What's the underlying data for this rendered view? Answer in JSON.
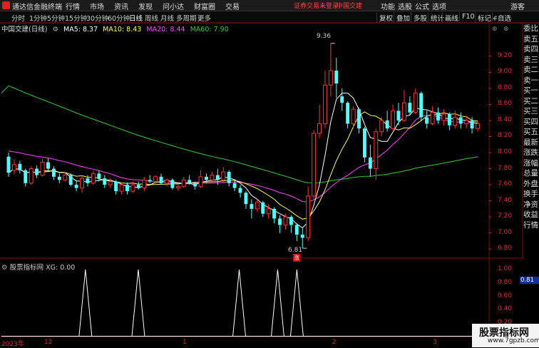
{
  "app": {
    "title": "通达信金融终端",
    "menus": [
      "行情",
      "市场",
      "资讯",
      "发现",
      "问小达",
      "财富圈",
      "交易"
    ],
    "warning": "证券交易未登录",
    "stock_link": "中国交建",
    "right_items": [
      "功能",
      "选股",
      "公式",
      "选项"
    ],
    "guest": "游客"
  },
  "toolbar": {
    "periods": [
      "分时",
      "1分钟",
      "5分钟",
      "15分钟",
      "30分钟",
      "60分钟",
      "日线",
      "周线",
      "月线",
      "多周期",
      "更多"
    ],
    "active": "日线",
    "right_buttons": [
      "复权",
      "叠加",
      "多股",
      "统计",
      "画线",
      "F10",
      "标记",
      "-"
    ]
  },
  "chart_header": {
    "name": "中国交建(日线)",
    "ma5": "MA5: 8.37",
    "ma10": "MA10: 8.43",
    "ma20": "MA20: 8.44",
    "ma60": "MA60: 7.90"
  },
  "colors": {
    "up": "#ff3333",
    "down": "#54ffff",
    "ma5": "#ffffff",
    "ma10": "#ffff4d",
    "ma20": "#ff44ff",
    "ma60": "#33cc33"
  },
  "high_label": "9.36",
  "low_label": "6.81",
  "zhang_label": "涨",
  "right_panel": {
    "items": [
      "委比",
      "卖五",
      "卖四",
      "卖三",
      "卖二",
      "卖一",
      "买一",
      "买二",
      "买三",
      "买四",
      "买五",
      "最新",
      "涨跌",
      "涨幅",
      "总量",
      "外盘",
      "换手",
      "净资",
      "收益",
      "行情"
    ],
    "auto_select": "+自选"
  },
  "indicator": {
    "name": "股票指标网",
    "value": "XG: 0.00",
    "current": "0.81",
    "spike_positions": [
      0.16,
      0.27,
      0.48,
      0.56,
      0.6
    ]
  },
  "x_labels": [
    "2023年",
    "12",
    "1",
    "2",
    "3"
  ],
  "watermark": {
    "title": "股票指标网",
    "url": "www.7gpzb.com"
  },
  "chart_data": {
    "type": "candlestick",
    "y_ticks": [
      9.2,
      9.0,
      8.8,
      8.6,
      8.4,
      8.2,
      8.0,
      7.8,
      7.6,
      7.4,
      7.2,
      7.0,
      6.8
    ],
    "indicator_ticks": [
      1.0,
      0.8,
      0.6,
      0.4,
      0.2
    ],
    "ylim": [
      6.74,
      9.5
    ],
    "candles": [
      [
        7.95,
        7.75,
        8.0,
        7.7
      ],
      [
        7.78,
        7.85,
        7.92,
        7.73
      ],
      [
        7.86,
        7.78,
        7.9,
        7.74
      ],
      [
        7.78,
        7.62,
        7.8,
        7.58
      ],
      [
        7.62,
        7.8,
        7.83,
        7.6
      ],
      [
        7.8,
        7.72,
        7.84,
        7.68
      ],
      [
        7.72,
        7.88,
        7.92,
        7.7
      ],
      [
        7.88,
        7.8,
        7.93,
        7.76
      ],
      [
        7.8,
        7.7,
        7.83,
        7.66
      ],
      [
        7.7,
        7.66,
        7.74,
        7.62
      ],
      [
        7.66,
        7.72,
        7.76,
        7.64
      ],
      [
        7.72,
        7.6,
        7.74,
        7.58
      ],
      [
        7.6,
        7.56,
        7.66,
        7.52
      ],
      [
        7.56,
        7.68,
        7.7,
        7.5
      ],
      [
        7.68,
        7.62,
        7.72,
        7.58
      ],
      [
        7.62,
        7.74,
        7.78,
        7.6
      ],
      [
        7.74,
        7.68,
        7.78,
        7.64
      ],
      [
        7.68,
        7.6,
        7.72,
        7.56
      ],
      [
        7.6,
        7.64,
        7.68,
        7.56
      ],
      [
        7.64,
        7.52,
        7.66,
        7.48
      ],
      [
        7.52,
        7.6,
        7.63,
        7.48
      ],
      [
        7.6,
        7.52,
        7.63,
        7.48
      ],
      [
        7.52,
        7.6,
        7.64,
        7.5
      ],
      [
        7.6,
        7.56,
        7.64,
        7.54
      ],
      [
        7.56,
        7.66,
        7.7,
        7.52
      ],
      [
        7.66,
        7.64,
        7.72,
        7.62
      ],
      [
        7.64,
        7.7,
        7.72,
        7.6
      ],
      [
        7.7,
        7.62,
        7.74,
        7.6
      ],
      [
        7.62,
        7.66,
        7.68,
        7.58
      ],
      [
        7.66,
        7.56,
        7.68,
        7.54
      ],
      [
        7.56,
        7.58,
        7.62,
        7.52
      ],
      [
        7.58,
        7.66,
        7.7,
        7.56
      ],
      [
        7.66,
        7.62,
        7.72,
        7.6
      ],
      [
        7.62,
        7.58,
        7.64,
        7.54
      ],
      [
        7.58,
        7.7,
        7.78,
        7.56
      ],
      [
        7.7,
        7.66,
        7.74,
        7.62
      ],
      [
        7.66,
        7.72,
        7.76,
        7.64
      ],
      [
        7.72,
        7.66,
        7.8,
        7.6
      ],
      [
        7.66,
        7.76,
        7.82,
        7.62
      ],
      [
        7.76,
        7.62,
        7.78,
        7.58
      ],
      [
        7.62,
        7.56,
        7.66,
        7.52
      ],
      [
        7.56,
        7.5,
        7.6,
        7.44
      ],
      [
        7.5,
        7.36,
        7.52,
        7.3
      ],
      [
        7.36,
        7.3,
        7.42,
        7.18
      ],
      [
        7.3,
        7.38,
        7.42,
        7.26
      ],
      [
        7.38,
        7.24,
        7.4,
        7.2
      ],
      [
        7.24,
        7.3,
        7.36,
        7.18
      ],
      [
        7.3,
        7.18,
        7.32,
        7.12
      ],
      [
        7.18,
        7.1,
        7.22,
        7.0
      ],
      [
        7.1,
        7.2,
        7.24,
        7.04
      ],
      [
        7.2,
        7.1,
        7.22,
        7.0
      ],
      [
        7.1,
        6.98,
        7.12,
        6.9
      ],
      [
        6.98,
        6.94,
        7.06,
        6.81
      ],
      [
        6.94,
        7.46,
        7.58,
        6.9
      ],
      [
        7.46,
        8.24,
        8.28,
        7.42
      ],
      [
        8.24,
        8.36,
        8.6,
        8.18
      ],
      [
        8.36,
        8.84,
        9.02,
        8.3
      ],
      [
        8.84,
        9.02,
        9.36,
        8.7
      ],
      [
        9.02,
        8.86,
        9.18,
        8.68
      ],
      [
        8.7,
        8.62,
        8.8,
        8.52
      ],
      [
        8.62,
        8.36,
        8.64,
        8.3
      ],
      [
        8.36,
        8.54,
        8.58,
        8.3
      ],
      [
        8.54,
        8.3,
        8.56,
        8.24
      ],
      [
        8.3,
        7.94,
        8.32,
        7.88
      ],
      [
        7.94,
        7.8,
        8.1,
        7.7
      ],
      [
        7.8,
        8.26,
        8.3,
        7.66
      ],
      [
        8.26,
        8.4,
        8.44,
        8.2
      ],
      [
        8.4,
        8.3,
        8.52,
        8.26
      ],
      [
        8.3,
        8.52,
        8.6,
        8.28
      ],
      [
        8.52,
        8.4,
        8.62,
        8.34
      ],
      [
        8.4,
        8.62,
        8.78,
        8.38
      ],
      [
        8.62,
        8.5,
        8.7,
        8.46
      ],
      [
        8.5,
        8.74,
        8.8,
        8.48
      ],
      [
        8.74,
        8.44,
        8.76,
        8.4
      ],
      [
        8.44,
        8.36,
        8.52,
        8.3
      ],
      [
        8.36,
        8.5,
        8.58,
        8.34
      ],
      [
        8.5,
        8.4,
        8.56,
        8.36
      ],
      [
        8.4,
        8.48,
        8.54,
        8.34
      ],
      [
        8.48,
        8.34,
        8.5,
        8.28
      ],
      [
        8.34,
        8.44,
        8.52,
        8.3
      ],
      [
        8.44,
        8.36,
        8.5,
        8.3
      ],
      [
        8.36,
        8.4,
        8.46,
        8.3
      ],
      [
        8.4,
        8.3,
        8.44,
        8.24
      ],
      [
        8.3,
        8.36,
        8.4,
        8.26
      ]
    ]
  }
}
